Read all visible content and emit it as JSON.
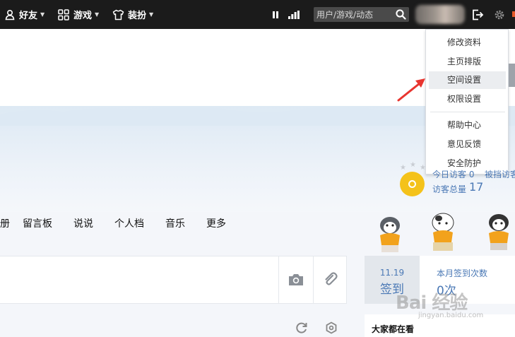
{
  "topbar": {
    "friends_label": "好友",
    "games_label": "游戏",
    "dress_label": "装扮",
    "search_placeholder": "用户/游戏/动态"
  },
  "dropdown": {
    "items": [
      "修改资料",
      "主页排版",
      "空间设置",
      "权限设置",
      "帮助中心",
      "意见反馈",
      "安全防护"
    ],
    "highlighted": "空间设置"
  },
  "visitor": {
    "today_label": "今日访客 0",
    "today_extra": "被挡访客",
    "total_label": "访客总量",
    "total_value": "17"
  },
  "nav": {
    "items": [
      "册",
      "留言板",
      "说说",
      "个人档",
      "音乐",
      "更多"
    ]
  },
  "signin": {
    "date": "11.19",
    "label": "签到",
    "monthly_label": "本月签到次数",
    "monthly_value": "0次"
  },
  "sidebar": {
    "everyone_watching": "大家都在看"
  },
  "watermark": {
    "text": "Bai 经验",
    "sub": "jingyan.baidu.com"
  },
  "colors": {
    "topbar_bg": "#1b1b1b",
    "accent_blue": "#4a78b5",
    "highlight_bg": "#ebedf0",
    "annotation_red": "#e8352f"
  }
}
